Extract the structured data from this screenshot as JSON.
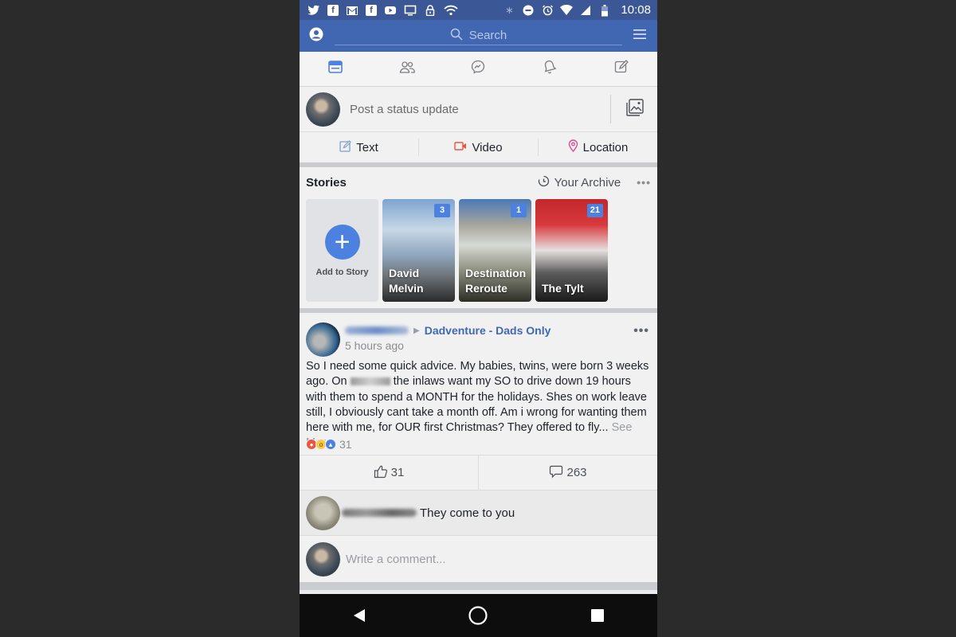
{
  "status_bar": {
    "notification_icons": [
      "twitter-icon",
      "facebook-icon",
      "gmail-icon",
      "facebook-icon",
      "youtube-icon",
      "tv-icon",
      "lock-icon",
      "wifi-icon"
    ],
    "system_icons": [
      "bluetooth-icon",
      "do-not-disturb-icon",
      "alarm-icon",
      "wifi-signal-icon",
      "cell-signal-icon",
      "battery-icon"
    ],
    "time": "10:08"
  },
  "search_bar": {
    "placeholder": "Search"
  },
  "nav_tabs": [
    {
      "name": "news-feed",
      "icon": "news-feed-icon",
      "active": true
    },
    {
      "name": "friends",
      "icon": "friends-icon",
      "active": false
    },
    {
      "name": "messenger",
      "icon": "messenger-icon",
      "active": false
    },
    {
      "name": "notifications",
      "icon": "bell-icon",
      "active": false
    },
    {
      "name": "compose",
      "icon": "compose-icon",
      "active": false
    }
  ],
  "composer": {
    "placeholder": "Post a status update",
    "actions": [
      {
        "label": "Text",
        "icon": "pencil-icon"
      },
      {
        "label": "Video",
        "icon": "video-camera-icon"
      },
      {
        "label": "Location",
        "icon": "location-pin-icon"
      }
    ]
  },
  "stories": {
    "title": "Stories",
    "archive_label": "Your Archive",
    "add_label": "Add to Story",
    "items": [
      {
        "name": "David Melvin",
        "count": "3"
      },
      {
        "name": "Destination Reroute",
        "count": "1"
      },
      {
        "name": "The Tylt",
        "count": "21"
      }
    ]
  },
  "post": {
    "group": "Dadventure - Dads Only",
    "time": "5 hours ago",
    "body_part1": "So I need some quick advice. My babies, twins, were born 3 weeks ago. On ",
    "body_part2": " the inlaws want my SO to drive down 19 hours with them to spend a MONTH for the holidays. Shes on work leave still, I obviously cant take a month off. Am i wrong for wanting them here with me, for OUR first Christmas? They offered to fly... ",
    "see_more": "See More",
    "reaction_count": "31",
    "like_count": "31",
    "comment_count": "263",
    "top_comment": "They come to you",
    "write_comment_placeholder": "Write a comment..."
  },
  "colors": {
    "brand_blue": "#4267b2",
    "status_bar": "#3b5796",
    "accent_blue": "#4d81e0"
  }
}
